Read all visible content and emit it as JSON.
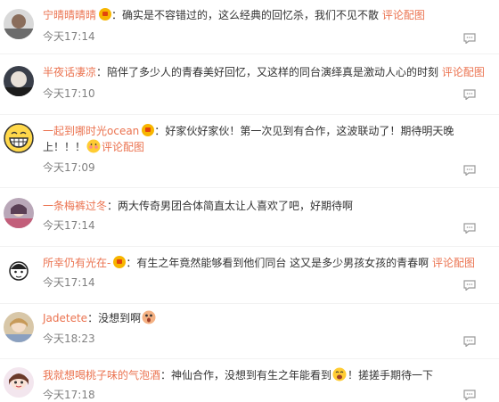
{
  "comments": [
    {
      "user": "宁晴晴晴晴",
      "has_badge": true,
      "text": "确实是不容错过的，这么经典的回忆杀，我们不见不散",
      "link": "评论配图",
      "time": "今天17:14"
    },
    {
      "user": "半夜话凄凉",
      "has_badge": false,
      "text": "陪伴了多少人的青春美好回忆，又这样的同台演绎真是激动人心的时刻",
      "link": "评论配图",
      "time": "今天17:10"
    },
    {
      "user": "一起到哪时光ocean",
      "has_badge": true,
      "text": "好家伙好家伙！第一次见到有合作，这波联动了！期待明天晚上！！！",
      "link": "评论配图",
      "time": "今天17:09"
    },
    {
      "user": "一条梅裤过冬",
      "has_badge": false,
      "text": "两大传奇男团合体简直太让人喜欢了吧，好期待啊",
      "link": "",
      "time": "今天17:14"
    },
    {
      "user": "所幸仍有光在-",
      "has_badge": true,
      "text": "有生之年竟然能够看到他们同台 这又是多少男孩女孩的青春啊",
      "link": "评论配图",
      "time": "今天17:14"
    },
    {
      "user": "Jadetete",
      "has_badge": false,
      "text": "没想到啊",
      "link": "",
      "time": "今天18:23"
    },
    {
      "user": "我就想喝桃子味的气泡酒",
      "has_badge": false,
      "text_before": "神仙合作，没想到有生之年能看到",
      "text_after": "！搓搓手期待一下",
      "link": "",
      "time": "今天17:18"
    }
  ],
  "colors": {
    "username": "#eb7350",
    "text": "#333333",
    "time": "#808080",
    "badge": "#f7b500"
  },
  "icons": [
    "reply-icon",
    "vip-badge-icon",
    "laughing-emoji-icon",
    "surprised-emoji-icon",
    "shy-emoji-icon"
  ]
}
